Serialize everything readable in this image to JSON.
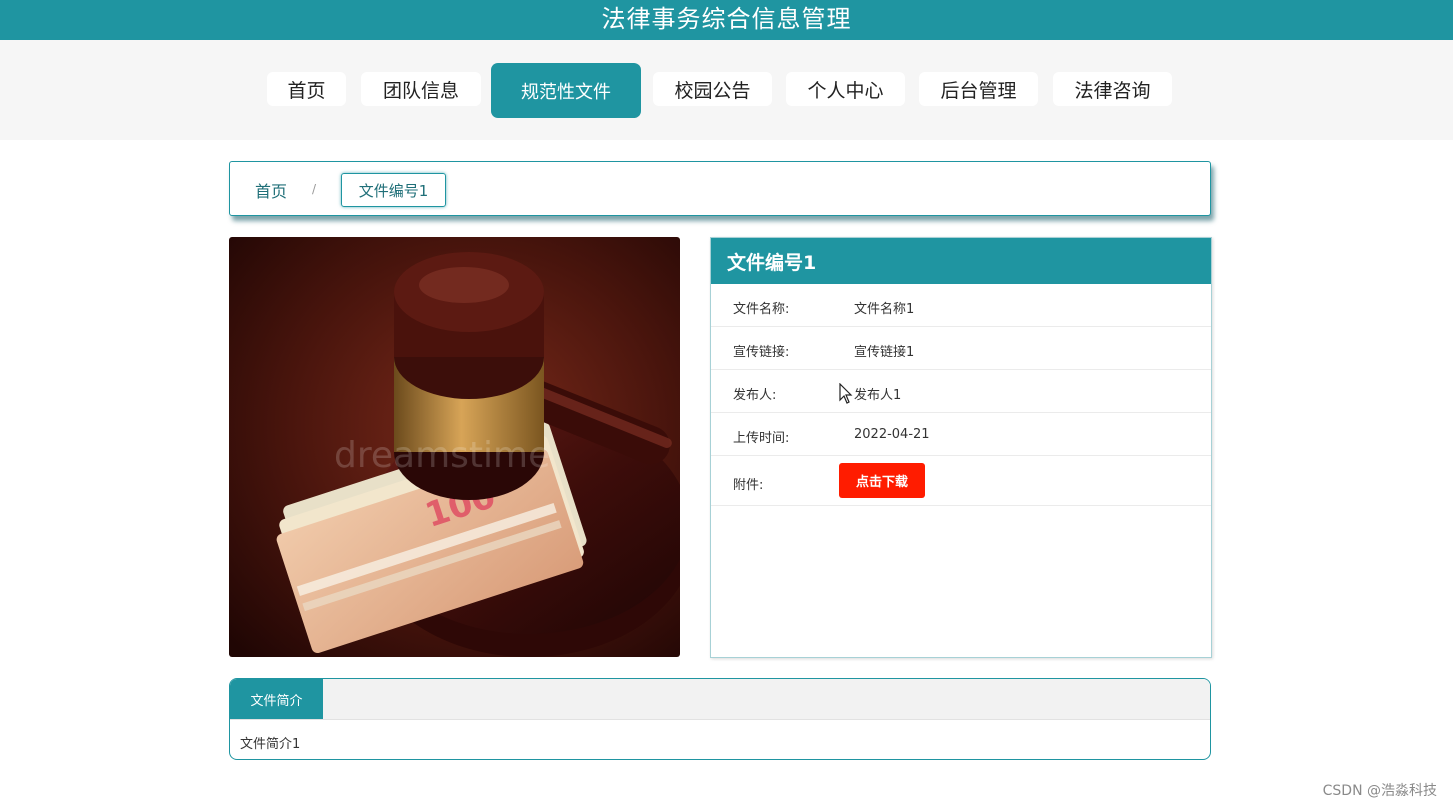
{
  "header": {
    "title": "法律事务综合信息管理"
  },
  "nav": {
    "items": [
      {
        "label": "首页"
      },
      {
        "label": "团队信息"
      },
      {
        "label": "规范性文件"
      },
      {
        "label": "校园公告"
      },
      {
        "label": "个人中心"
      },
      {
        "label": "后台管理"
      },
      {
        "label": "法律咨询"
      }
    ],
    "active_index": 2
  },
  "breadcrumb": {
    "home": "首页",
    "separator": "/",
    "current": "文件编号1"
  },
  "detail": {
    "title": "文件编号1",
    "rows": [
      {
        "label": "文件名称:",
        "value": "文件名称1"
      },
      {
        "label": "宣传链接:",
        "value": "宣传链接1"
      },
      {
        "label": "发布人:",
        "value": "发布人1"
      },
      {
        "label": "上传时间:",
        "value": "2022-04-21"
      }
    ],
    "attachment_label": "附件:",
    "download_label": "点击下载"
  },
  "photo": {
    "watermark_text": "dreamstime",
    "banknote_value": "100"
  },
  "tabs": {
    "active_label": "文件简介",
    "content": "文件简介1"
  },
  "watermark": "CSDN @浩淼科技",
  "colors": {
    "primary": "#1f95a1",
    "download": "#ff1c00",
    "nav_bg": "#f6f6f6"
  }
}
